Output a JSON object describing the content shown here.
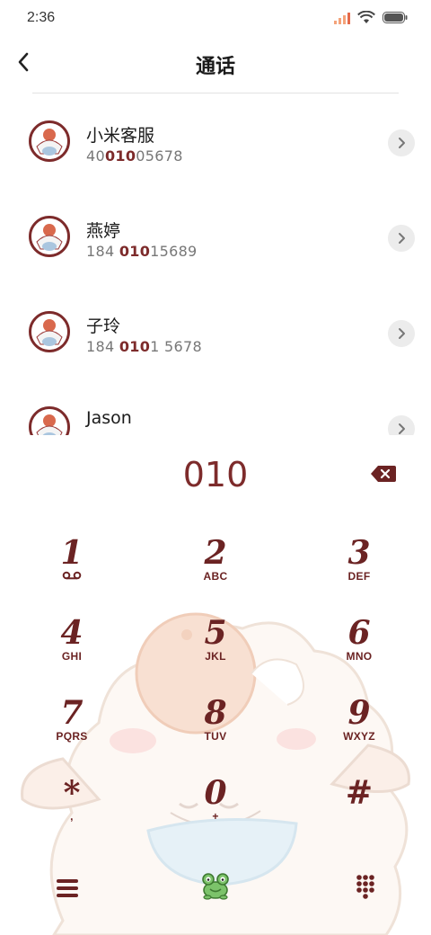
{
  "status_bar": {
    "time": "2:36",
    "icons": [
      "signal-icon",
      "wifi-icon",
      "battery-icon"
    ]
  },
  "header": {
    "title": "通话",
    "back_icon": "chevron-left-icon"
  },
  "contacts": [
    {
      "name": "小米客服",
      "number_pre": "40",
      "number_match": "010",
      "number_post": "05678"
    },
    {
      "name": "燕婷",
      "number_pre": "184 ",
      "number_match": "010",
      "number_post": "15689"
    },
    {
      "name": "子玲",
      "number_pre": "184 ",
      "number_match": "010",
      "number_post": "1 5678"
    },
    {
      "name": "Jason",
      "number_pre": "",
      "number_match": "",
      "number_post": ""
    }
  ],
  "dialer": {
    "input_value": "010",
    "keys": [
      {
        "digit": "1",
        "letters": ""
      },
      {
        "digit": "2",
        "letters": "ABC"
      },
      {
        "digit": "3",
        "letters": "DEF"
      },
      {
        "digit": "4",
        "letters": "GHI"
      },
      {
        "digit": "5",
        "letters": "JKL"
      },
      {
        "digit": "6",
        "letters": "MNO"
      },
      {
        "digit": "7",
        "letters": "PQRS"
      },
      {
        "digit": "8",
        "letters": "TUV"
      },
      {
        "digit": "9",
        "letters": "WXYZ"
      },
      {
        "digit": "*",
        "letters": ","
      },
      {
        "digit": "0",
        "letters": "+"
      },
      {
        "digit": "#",
        "letters": ""
      }
    ]
  },
  "colors": {
    "accent": "#7d2b2b",
    "chevron_bg": "#ececec",
    "divider": "#e2e2e2"
  }
}
